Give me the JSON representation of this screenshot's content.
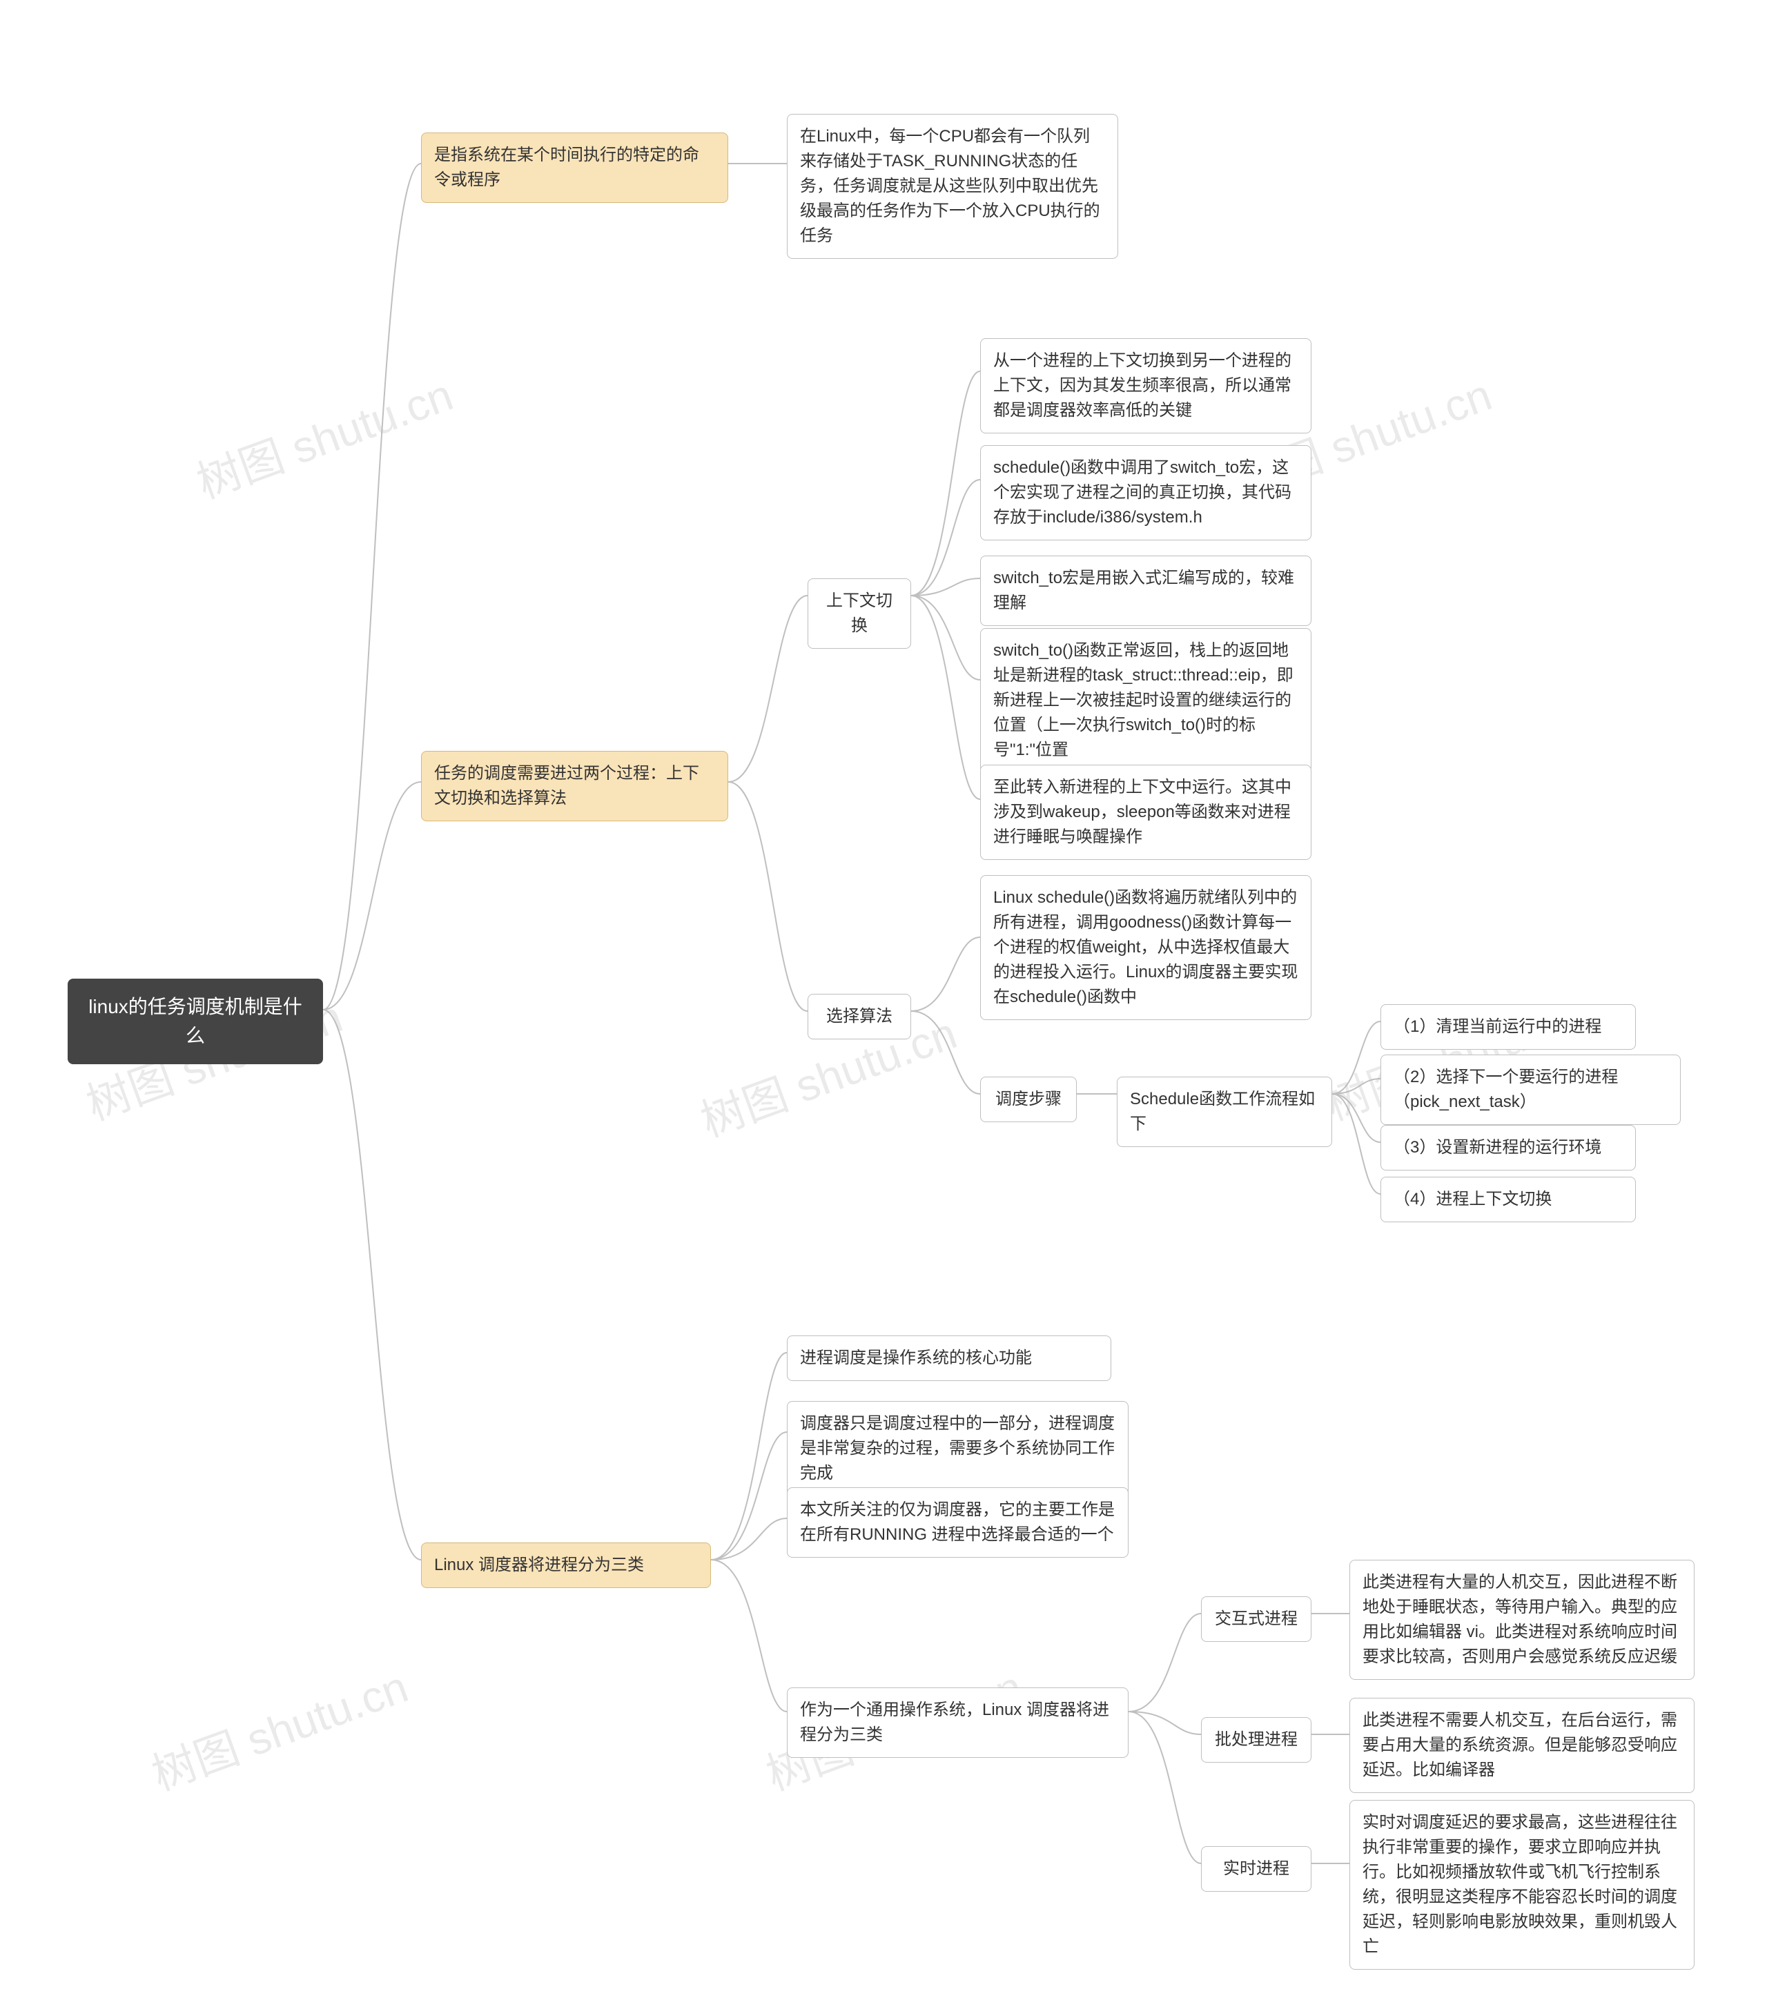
{
  "watermark": "树图 shutu.cn",
  "root": "linux的任务调度机制是什么",
  "b1": {
    "title": "是指系统在某个时间执行的特定的命令或程序",
    "desc": "在Linux中，每一个CPU都会有一个队列来存储处于TASK_RUNNING状态的任务，任务调度就是从这些队列中取出优先级最高的任务作为下一个放入CPU执行的任务"
  },
  "b2": {
    "title": "任务的调度需要进过两个过程：上下文切换和选择算法",
    "ctx": {
      "label": "上下文切换",
      "c1": "从一个进程的上下文切换到另一个进程的上下文，因为其发生频率很高，所以通常都是调度器效率高低的关键",
      "c2": "schedule()函数中调用了switch_to宏，这个宏实现了进程之间的真正切换，其代码存放于include/i386/system.h",
      "c3": "switch_to宏是用嵌入式汇编写成的，较难理解",
      "c4": "switch_to()函数正常返回，栈上的返回地址是新进程的task_struct::thread::eip，即新进程上一次被挂起时设置的继续运行的位置（上一次执行switch_to()时的标号\"1:\"位置",
      "c5": "至此转入新进程的上下文中运行。这其中涉及到wakeup，sleepon等函数来对进程进行睡眠与唤醒操作"
    },
    "sel": {
      "label": "选择算法",
      "desc": "Linux schedule()函数将遍历就绪队列中的所有进程，调用goodness()函数计算每一个进程的权值weight，从中选择权值最大的进程投入运行。Linux的调度器主要实现在schedule()函数中",
      "steps": {
        "label": "调度步骤",
        "sub": "Schedule函数工作流程如下",
        "s1": "（1）清理当前运行中的进程",
        "s2": "（2）选择下一个要运行的进程（pick_next_task）",
        "s3": "（3）设置新进程的运行环境",
        "s4": "（4）进程上下文切换"
      }
    }
  },
  "b3": {
    "title": "Linux 调度器将进程分为三类",
    "p1": "进程调度是操作系统的核心功能",
    "p2": "调度器只是调度过程中的一部分，进程调度是非常复杂的过程，需要多个系统协同工作完成",
    "p3": "本文所关注的仅为调度器，它的主要工作是在所有RUNNING 进程中选择最合适的一个",
    "cat": {
      "label": "作为一个通用操作系统，Linux 调度器将进程分为三类",
      "i": {
        "label": "交互式进程",
        "desc": "此类进程有大量的人机交互，因此进程不断地处于睡眠状态，等待用户输入。典型的应用比如编辑器 vi。此类进程对系统响应时间要求比较高，否则用户会感觉系统反应迟缓"
      },
      "b": {
        "label": "批处理进程",
        "desc": "此类进程不需要人机交互，在后台运行，需要占用大量的系统资源。但是能够忍受响应延迟。比如编译器"
      },
      "r": {
        "label": "实时进程",
        "desc": "实时对调度延迟的要求最高，这些进程往往执行非常重要的操作，要求立即响应并执行。比如视频播放软件或飞机飞行控制系统，很明显这类程序不能容忍长时间的调度延迟，轻则影响电影放映效果，重则机毁人亡"
      }
    }
  }
}
